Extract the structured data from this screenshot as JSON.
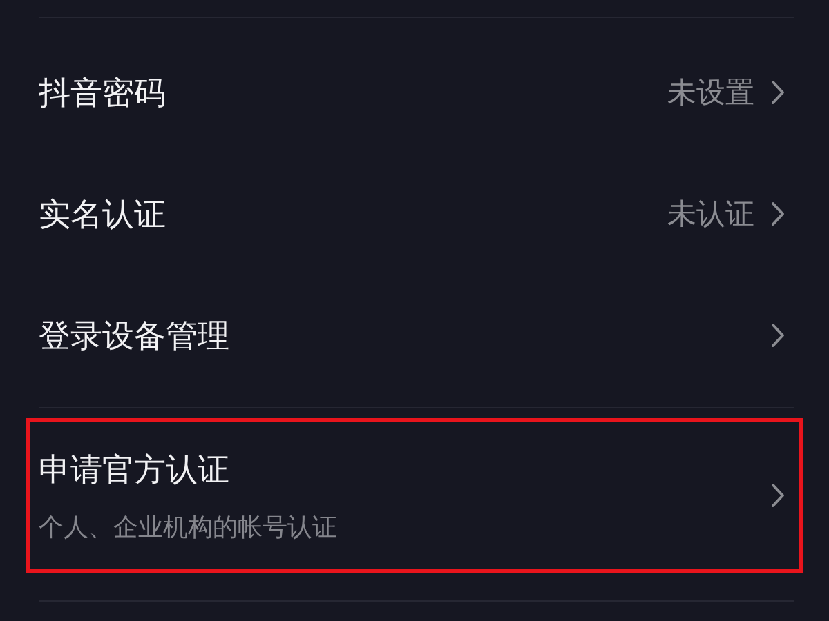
{
  "settings": [
    {
      "title": "抖音密码",
      "value": "未设置",
      "highlighted": false
    },
    {
      "title": "实名认证",
      "value": "未认证",
      "highlighted": false
    },
    {
      "title": "登录设备管理",
      "highlighted": false
    },
    {
      "title": "申请官方认证",
      "subtitle": "个人、企业机构的帐号认证",
      "highlighted": true
    }
  ]
}
